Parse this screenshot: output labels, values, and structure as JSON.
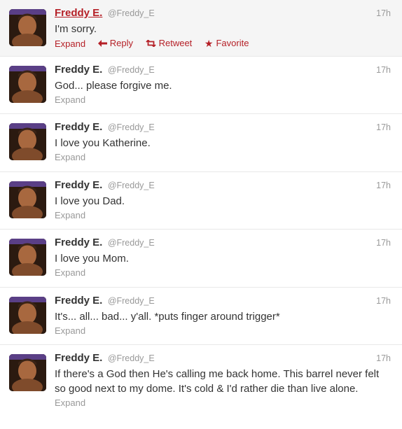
{
  "tweets": [
    {
      "name": "Freddy E.",
      "handle": "@Freddy_E",
      "time": "17h",
      "text": "I'm sorry.",
      "expand": "Expand",
      "actions": {
        "reply": "Reply",
        "retweet": "Retweet",
        "favorite": "Favorite"
      }
    },
    {
      "name": "Freddy E.",
      "handle": "@Freddy_E",
      "time": "17h",
      "text": "God... please forgive me.",
      "expand": "Expand"
    },
    {
      "name": "Freddy E.",
      "handle": "@Freddy_E",
      "time": "17h",
      "text": "I love you Katherine.",
      "expand": "Expand"
    },
    {
      "name": "Freddy E.",
      "handle": "@Freddy_E",
      "time": "17h",
      "text": "I love you Dad.",
      "expand": "Expand"
    },
    {
      "name": "Freddy E.",
      "handle": "@Freddy_E",
      "time": "17h",
      "text": "I love you Mom.",
      "expand": "Expand"
    },
    {
      "name": "Freddy E.",
      "handle": "@Freddy_E",
      "time": "17h",
      "text": "It's... all... bad... y'all. *puts finger around trigger*",
      "expand": "Expand"
    },
    {
      "name": "Freddy E.",
      "handle": "@Freddy_E",
      "time": "17h",
      "text": "If there's a God then He's calling me back home. This barrel never felt so good next to my dome. It's cold & I'd rather die than live alone.",
      "expand": "Expand"
    }
  ],
  "colors": {
    "accent": "#b52027",
    "muted": "#999999",
    "hover_bg": "#f5f5f5",
    "divider": "#e8e8e8"
  },
  "icons": {
    "reply": "reply-arrow-icon",
    "retweet": "retweet-icon",
    "favorite": "star-icon"
  }
}
